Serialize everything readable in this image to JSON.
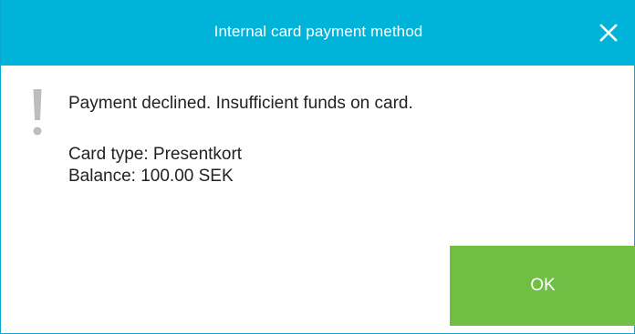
{
  "dialog": {
    "title": "Internal card payment method",
    "close_icon": "close-icon",
    "warning_icon": "exclamation-icon",
    "message": "Payment declined. Insufficient funds on card.",
    "card_type_line": "Card type: Presentkort",
    "balance_line": "Balance: 100.00 SEK",
    "ok_label": "OK"
  },
  "colors": {
    "titlebar": "#00b4d9",
    "ok_button": "#6fbf44",
    "warning_icon": "#bdbdbd",
    "text": "#222222"
  }
}
